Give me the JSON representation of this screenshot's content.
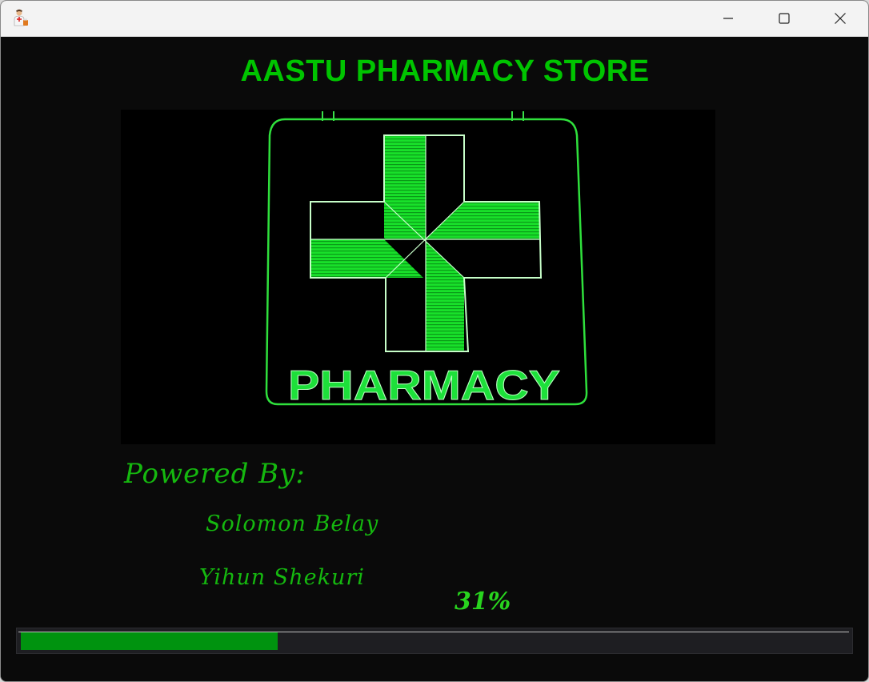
{
  "window": {
    "title": "",
    "icon": "pharmacist-icon"
  },
  "controls": {
    "minimize_icon": "minimize-icon",
    "maximize_icon": "maximize-icon",
    "close_icon": "close-icon"
  },
  "header": {
    "title": "AASTU PHARMACY STORE"
  },
  "banner": {
    "text": "PHARMACY",
    "icon": "pharmacy-cross-icon",
    "accent_color": "#00e53a"
  },
  "credits": {
    "heading": "Powered By:",
    "authors": [
      "Solomon Belay",
      "Yihun Shekuri"
    ]
  },
  "progress": {
    "label": "31%",
    "value": 0.31,
    "fill_color": "#00930f",
    "track_color": "#1e1e22"
  },
  "colors": {
    "background": "#0a0a0a",
    "text_green": "#00c400"
  }
}
